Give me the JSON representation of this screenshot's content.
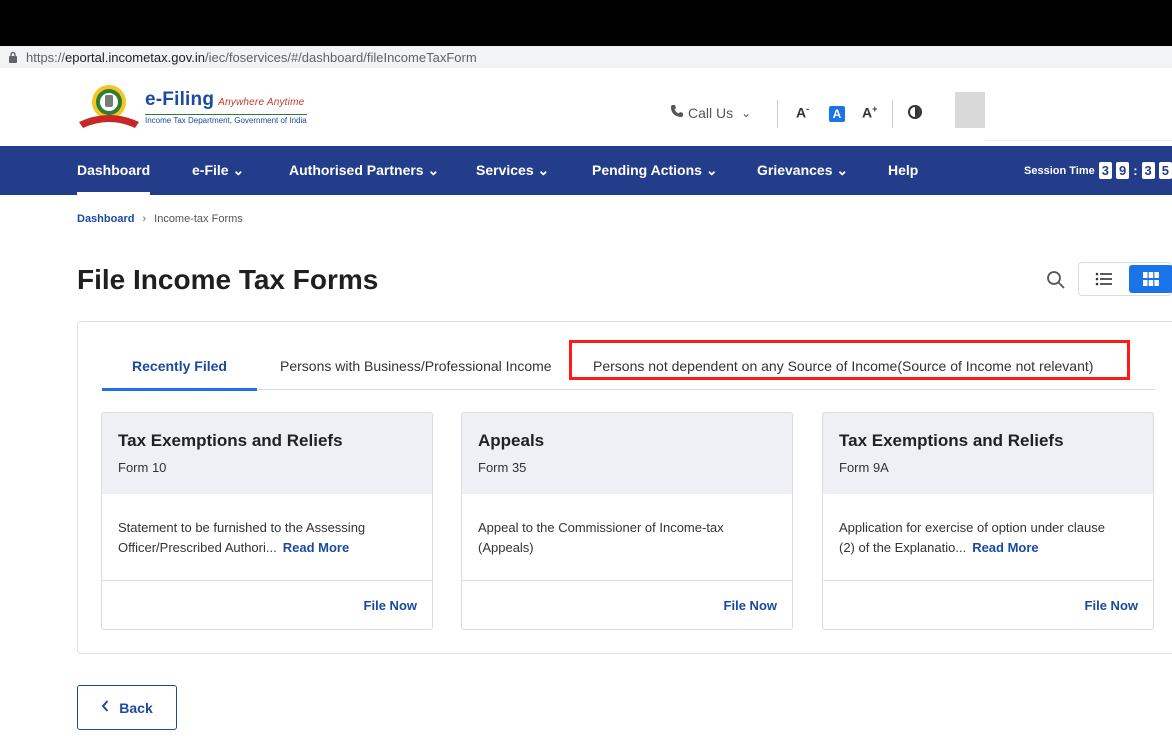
{
  "browser": {
    "url_prefix": "https://",
    "url_host": "eportal.incometax.gov.in",
    "url_path": "/iec/foservices/#/dashboard/fileIncomeTaxForm"
  },
  "brand": {
    "title": "e-Filing",
    "tagline": "Anywhere Anytime",
    "subtitle": "Income Tax Department, Government of India"
  },
  "header": {
    "call_us": "Call Us",
    "font_decrease": "A",
    "font_default": "A",
    "font_increase": "A",
    "font_decrease_sup": "-",
    "font_increase_sup": "+"
  },
  "nav": {
    "items": [
      {
        "label": "Dashboard"
      },
      {
        "label": "e-File ⌄"
      },
      {
        "label": "Authorised Partners ⌄"
      },
      {
        "label": "Services ⌄"
      },
      {
        "label": "Pending Actions ⌄"
      },
      {
        "label": "Grievances ⌄"
      },
      {
        "label": "Help"
      }
    ],
    "session_label": "Session Time",
    "session_digits": [
      "3",
      "9",
      ":",
      "3",
      "5"
    ]
  },
  "breadcrumb": {
    "home": "Dashboard",
    "separator": "›",
    "current": "Income-tax Forms"
  },
  "page": {
    "title": "File Income Tax Forms"
  },
  "tabs": [
    {
      "label": "Recently Filed"
    },
    {
      "label": "Persons with Business/Professional Income"
    },
    {
      "label": "Persons not dependent on any Source of Income(Source of Income not relevant)"
    }
  ],
  "cards": [
    {
      "title": "Tax Exemptions and Reliefs",
      "form": "Form 10",
      "desc_line1": "Statement to be furnished to the Assessing",
      "desc_line2": "Officer/Prescribed Authori...",
      "read_more": "Read More",
      "action": "File Now"
    },
    {
      "title": "Appeals",
      "form": "Form 35",
      "desc_line1": "Appeal to the Commissioner of Income-tax",
      "desc_line2": "(Appeals)",
      "read_more": "",
      "action": "File Now"
    },
    {
      "title": "Tax Exemptions and Reliefs",
      "form": "Form 9A",
      "desc_line1": "Application for exercise of option under clause",
      "desc_line2": "(2) of the Explanatio...",
      "read_more": "Read More",
      "action": "File Now"
    }
  ],
  "back_button": {
    "label": "Back"
  },
  "colors": {
    "nav_bg": "#233d8a",
    "accent": "#1a73e8",
    "link": "#1a4aa3",
    "highlight": "#ff1a1a"
  }
}
